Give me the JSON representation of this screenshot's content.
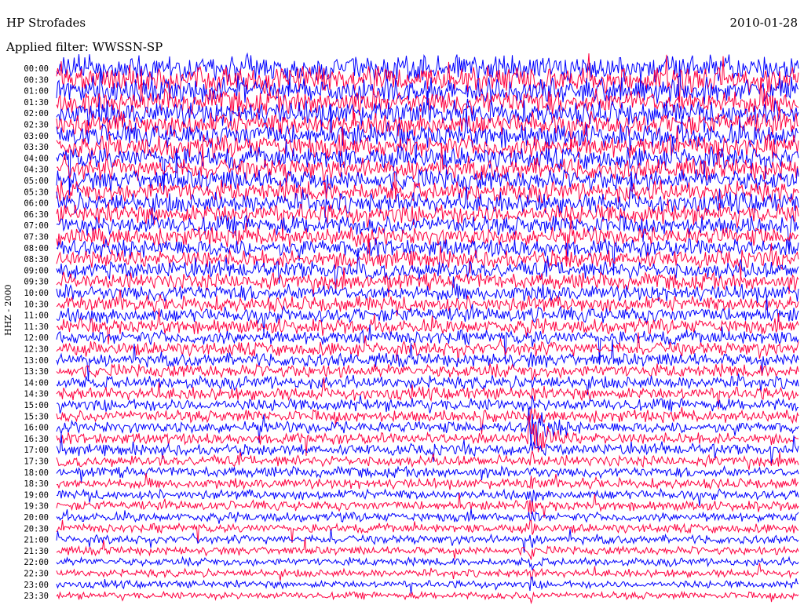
{
  "header": {
    "station": "HP Strofades",
    "date": "2010-01-28",
    "filter": "Applied filter: WWSSN-SP"
  },
  "chart_data": {
    "type": "line",
    "ylabel": "HHZ - 2000",
    "row_labels": [
      "00:00",
      "00:30",
      "01:00",
      "01:30",
      "02:00",
      "02:30",
      "03:00",
      "03:30",
      "04:00",
      "04:30",
      "05:00",
      "05:30",
      "06:00",
      "06:30",
      "07:00",
      "07:30",
      "08:00",
      "08:30",
      "09:00",
      "09:30",
      "10:00",
      "10:30",
      "11:00",
      "11:30",
      "12:00",
      "12:30",
      "13:00",
      "13:30",
      "14:00",
      "14:30",
      "15:00",
      "15:30",
      "16:00",
      "16:30",
      "17:00",
      "17:30",
      "18:00",
      "18:30",
      "19:00",
      "19:30",
      "20:00",
      "20:30",
      "21:00",
      "21:30",
      "22:00",
      "22:30",
      "23:00",
      "23:30"
    ],
    "colors": [
      "#0000ff",
      "#ff0040"
    ],
    "event_row_start": "16:00",
    "event_x_fraction": 0.64,
    "noise_trend": "high amplitude 00:00-12:00, decreasing toward 23:30"
  }
}
